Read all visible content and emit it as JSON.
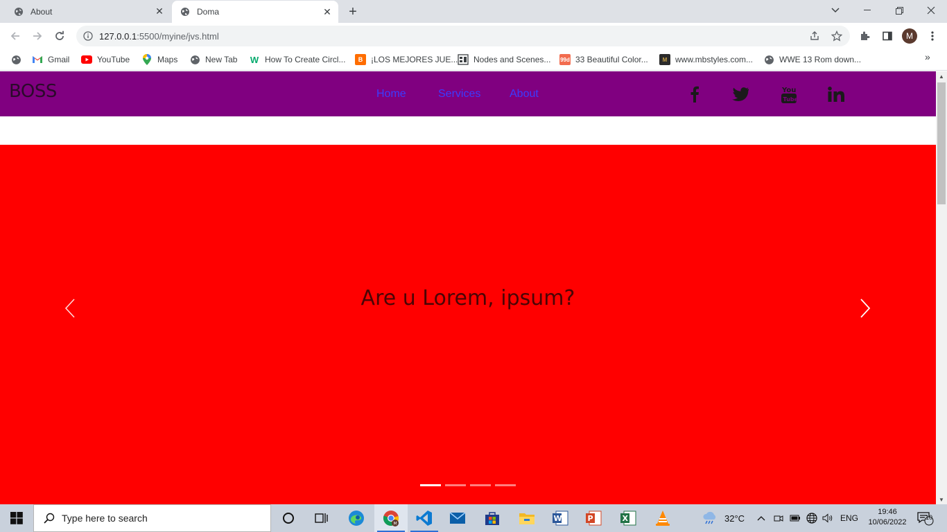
{
  "browser": {
    "tabs": [
      {
        "title": "About",
        "active": false
      },
      {
        "title": "Doma",
        "active": true
      }
    ],
    "url_host": "127.0.0.1",
    "url_path": ":5500/myine/jvs.html",
    "profile_initial": "M",
    "bookmarks": [
      {
        "label": "Gmail",
        "icon": "gmail-icon"
      },
      {
        "label": "YouTube",
        "icon": "youtube-icon"
      },
      {
        "label": "Maps",
        "icon": "maps-icon"
      },
      {
        "label": "New Tab",
        "icon": "globe-icon"
      },
      {
        "label": "How To Create Circl...",
        "icon": "w3schools-icon"
      },
      {
        "label": "¡LOS MEJORES JUE...",
        "icon": "blogger-icon"
      },
      {
        "label": "Nodes and Scenes...",
        "icon": "godot-docs-icon"
      },
      {
        "label": "33 Beautiful Color...",
        "icon": "99designs-icon"
      },
      {
        "label": "www.mbstyles.com...",
        "icon": "mbstyles-icon"
      },
      {
        "label": "WWE 13 Rom down...",
        "icon": "globe-icon"
      }
    ]
  },
  "site": {
    "brand": "BOSS",
    "nav": [
      "Home",
      "Services",
      "About"
    ],
    "social": [
      "facebook-icon",
      "twitter-icon",
      "youtube-icon",
      "linkedin-icon"
    ],
    "slide_caption": "Are u Lorem, ipsum?",
    "slide_count": 4,
    "active_slide": 1,
    "colors": {
      "navbar": "#800080",
      "slide_background": "#ff0000",
      "nav_link": "#3c3cff"
    }
  },
  "taskbar": {
    "search_placeholder": "Type here to search",
    "weather": "32°C",
    "language": "ENG",
    "time": "19:46",
    "date": "10/06/2022",
    "notification_count": "10"
  }
}
